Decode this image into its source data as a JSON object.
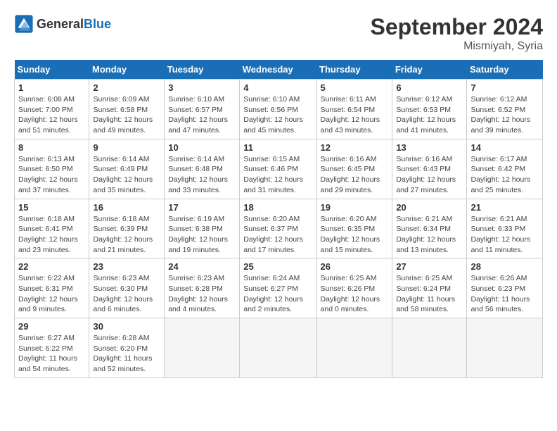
{
  "logo": {
    "general": "General",
    "blue": "Blue"
  },
  "title": "September 2024",
  "location": "Mismiyah, Syria",
  "days_of_week": [
    "Sunday",
    "Monday",
    "Tuesday",
    "Wednesday",
    "Thursday",
    "Friday",
    "Saturday"
  ],
  "weeks": [
    [
      {
        "day": "1",
        "sunrise": "6:08 AM",
        "sunset": "7:00 PM",
        "daylight": "12 hours and 51 minutes."
      },
      {
        "day": "2",
        "sunrise": "6:09 AM",
        "sunset": "6:58 PM",
        "daylight": "12 hours and 49 minutes."
      },
      {
        "day": "3",
        "sunrise": "6:10 AM",
        "sunset": "6:57 PM",
        "daylight": "12 hours and 47 minutes."
      },
      {
        "day": "4",
        "sunrise": "6:10 AM",
        "sunset": "6:56 PM",
        "daylight": "12 hours and 45 minutes."
      },
      {
        "day": "5",
        "sunrise": "6:11 AM",
        "sunset": "6:54 PM",
        "daylight": "12 hours and 43 minutes."
      },
      {
        "day": "6",
        "sunrise": "6:12 AM",
        "sunset": "6:53 PM",
        "daylight": "12 hours and 41 minutes."
      },
      {
        "day": "7",
        "sunrise": "6:12 AM",
        "sunset": "6:52 PM",
        "daylight": "12 hours and 39 minutes."
      }
    ],
    [
      {
        "day": "8",
        "sunrise": "6:13 AM",
        "sunset": "6:50 PM",
        "daylight": "12 hours and 37 minutes."
      },
      {
        "day": "9",
        "sunrise": "6:14 AM",
        "sunset": "6:49 PM",
        "daylight": "12 hours and 35 minutes."
      },
      {
        "day": "10",
        "sunrise": "6:14 AM",
        "sunset": "6:48 PM",
        "daylight": "12 hours and 33 minutes."
      },
      {
        "day": "11",
        "sunrise": "6:15 AM",
        "sunset": "6:46 PM",
        "daylight": "12 hours and 31 minutes."
      },
      {
        "day": "12",
        "sunrise": "6:16 AM",
        "sunset": "6:45 PM",
        "daylight": "12 hours and 29 minutes."
      },
      {
        "day": "13",
        "sunrise": "6:16 AM",
        "sunset": "6:43 PM",
        "daylight": "12 hours and 27 minutes."
      },
      {
        "day": "14",
        "sunrise": "6:17 AM",
        "sunset": "6:42 PM",
        "daylight": "12 hours and 25 minutes."
      }
    ],
    [
      {
        "day": "15",
        "sunrise": "6:18 AM",
        "sunset": "6:41 PM",
        "daylight": "12 hours and 23 minutes."
      },
      {
        "day": "16",
        "sunrise": "6:18 AM",
        "sunset": "6:39 PM",
        "daylight": "12 hours and 21 minutes."
      },
      {
        "day": "17",
        "sunrise": "6:19 AM",
        "sunset": "6:38 PM",
        "daylight": "12 hours and 19 minutes."
      },
      {
        "day": "18",
        "sunrise": "6:20 AM",
        "sunset": "6:37 PM",
        "daylight": "12 hours and 17 minutes."
      },
      {
        "day": "19",
        "sunrise": "6:20 AM",
        "sunset": "6:35 PM",
        "daylight": "12 hours and 15 minutes."
      },
      {
        "day": "20",
        "sunrise": "6:21 AM",
        "sunset": "6:34 PM",
        "daylight": "12 hours and 13 minutes."
      },
      {
        "day": "21",
        "sunrise": "6:21 AM",
        "sunset": "6:33 PM",
        "daylight": "12 hours and 11 minutes."
      }
    ],
    [
      {
        "day": "22",
        "sunrise": "6:22 AM",
        "sunset": "6:31 PM",
        "daylight": "12 hours and 9 minutes."
      },
      {
        "day": "23",
        "sunrise": "6:23 AM",
        "sunset": "6:30 PM",
        "daylight": "12 hours and 6 minutes."
      },
      {
        "day": "24",
        "sunrise": "6:23 AM",
        "sunset": "6:28 PM",
        "daylight": "12 hours and 4 minutes."
      },
      {
        "day": "25",
        "sunrise": "6:24 AM",
        "sunset": "6:27 PM",
        "daylight": "12 hours and 2 minutes."
      },
      {
        "day": "26",
        "sunrise": "6:25 AM",
        "sunset": "6:26 PM",
        "daylight": "12 hours and 0 minutes."
      },
      {
        "day": "27",
        "sunrise": "6:25 AM",
        "sunset": "6:24 PM",
        "daylight": "11 hours and 58 minutes."
      },
      {
        "day": "28",
        "sunrise": "6:26 AM",
        "sunset": "6:23 PM",
        "daylight": "11 hours and 56 minutes."
      }
    ],
    [
      {
        "day": "29",
        "sunrise": "6:27 AM",
        "sunset": "6:22 PM",
        "daylight": "11 hours and 54 minutes."
      },
      {
        "day": "30",
        "sunrise": "6:28 AM",
        "sunset": "6:20 PM",
        "daylight": "11 hours and 52 minutes."
      },
      null,
      null,
      null,
      null,
      null
    ]
  ]
}
